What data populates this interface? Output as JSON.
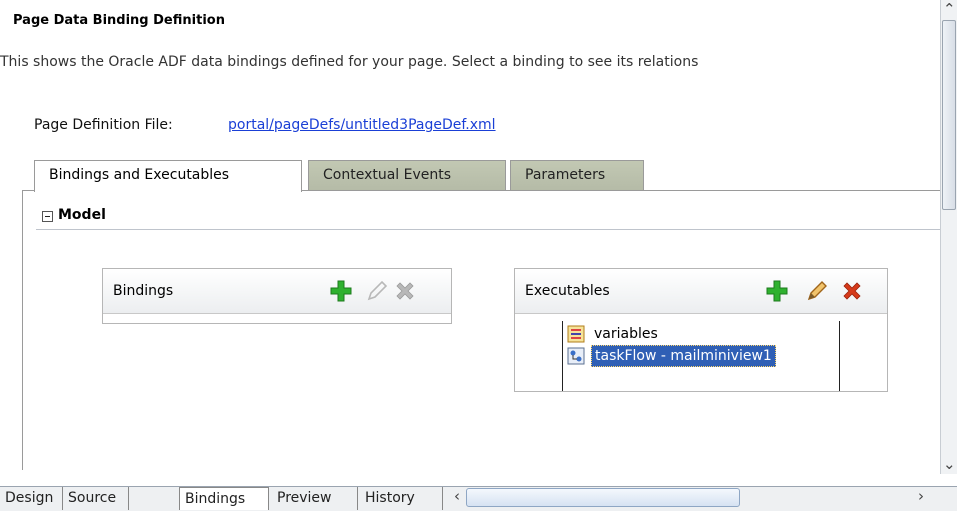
{
  "page": {
    "title": "Page Data Binding Definition",
    "description": "This shows the Oracle ADF data bindings defined for your page. Select a binding to see its relations",
    "page_definition_label": "Page Definition File:",
    "page_definition_link": "portal/pageDefs/untitled3PageDef.xml"
  },
  "tabs": [
    {
      "label": "Bindings and Executables",
      "active": true
    },
    {
      "label": "Contextual Events",
      "active": false
    },
    {
      "label": "Parameters",
      "active": false
    }
  ],
  "model": {
    "label": "Model",
    "expanded": true
  },
  "bindings_panel": {
    "title": "Bindings",
    "actions": [
      {
        "icon": "add-icon"
      },
      {
        "icon": "edit-icon"
      },
      {
        "icon": "delete-icon"
      }
    ]
  },
  "executables_panel": {
    "title": "Executables",
    "actions": [
      {
        "icon": "add-icon"
      },
      {
        "icon": "edit-icon"
      },
      {
        "icon": "delete-icon"
      }
    ],
    "items": [
      {
        "label": "variables",
        "icon": "variables-icon",
        "selected": false
      },
      {
        "label": "taskFlow - mailminiview1",
        "icon": "taskflow-icon",
        "selected": true
      }
    ]
  },
  "bottom_tabs": [
    {
      "label": "Design",
      "selected": false
    },
    {
      "label": "Source",
      "selected": false
    },
    {
      "label": "Bindings",
      "selected": true
    },
    {
      "label": "Preview",
      "selected": false
    },
    {
      "label": "History",
      "selected": false
    }
  ],
  "colors": {
    "link": "#1a3fd6",
    "add": "#2fb12f",
    "delete": "#d63a1a",
    "selection": "#2f5fb5",
    "inactive_tab": "#b5bba7"
  }
}
